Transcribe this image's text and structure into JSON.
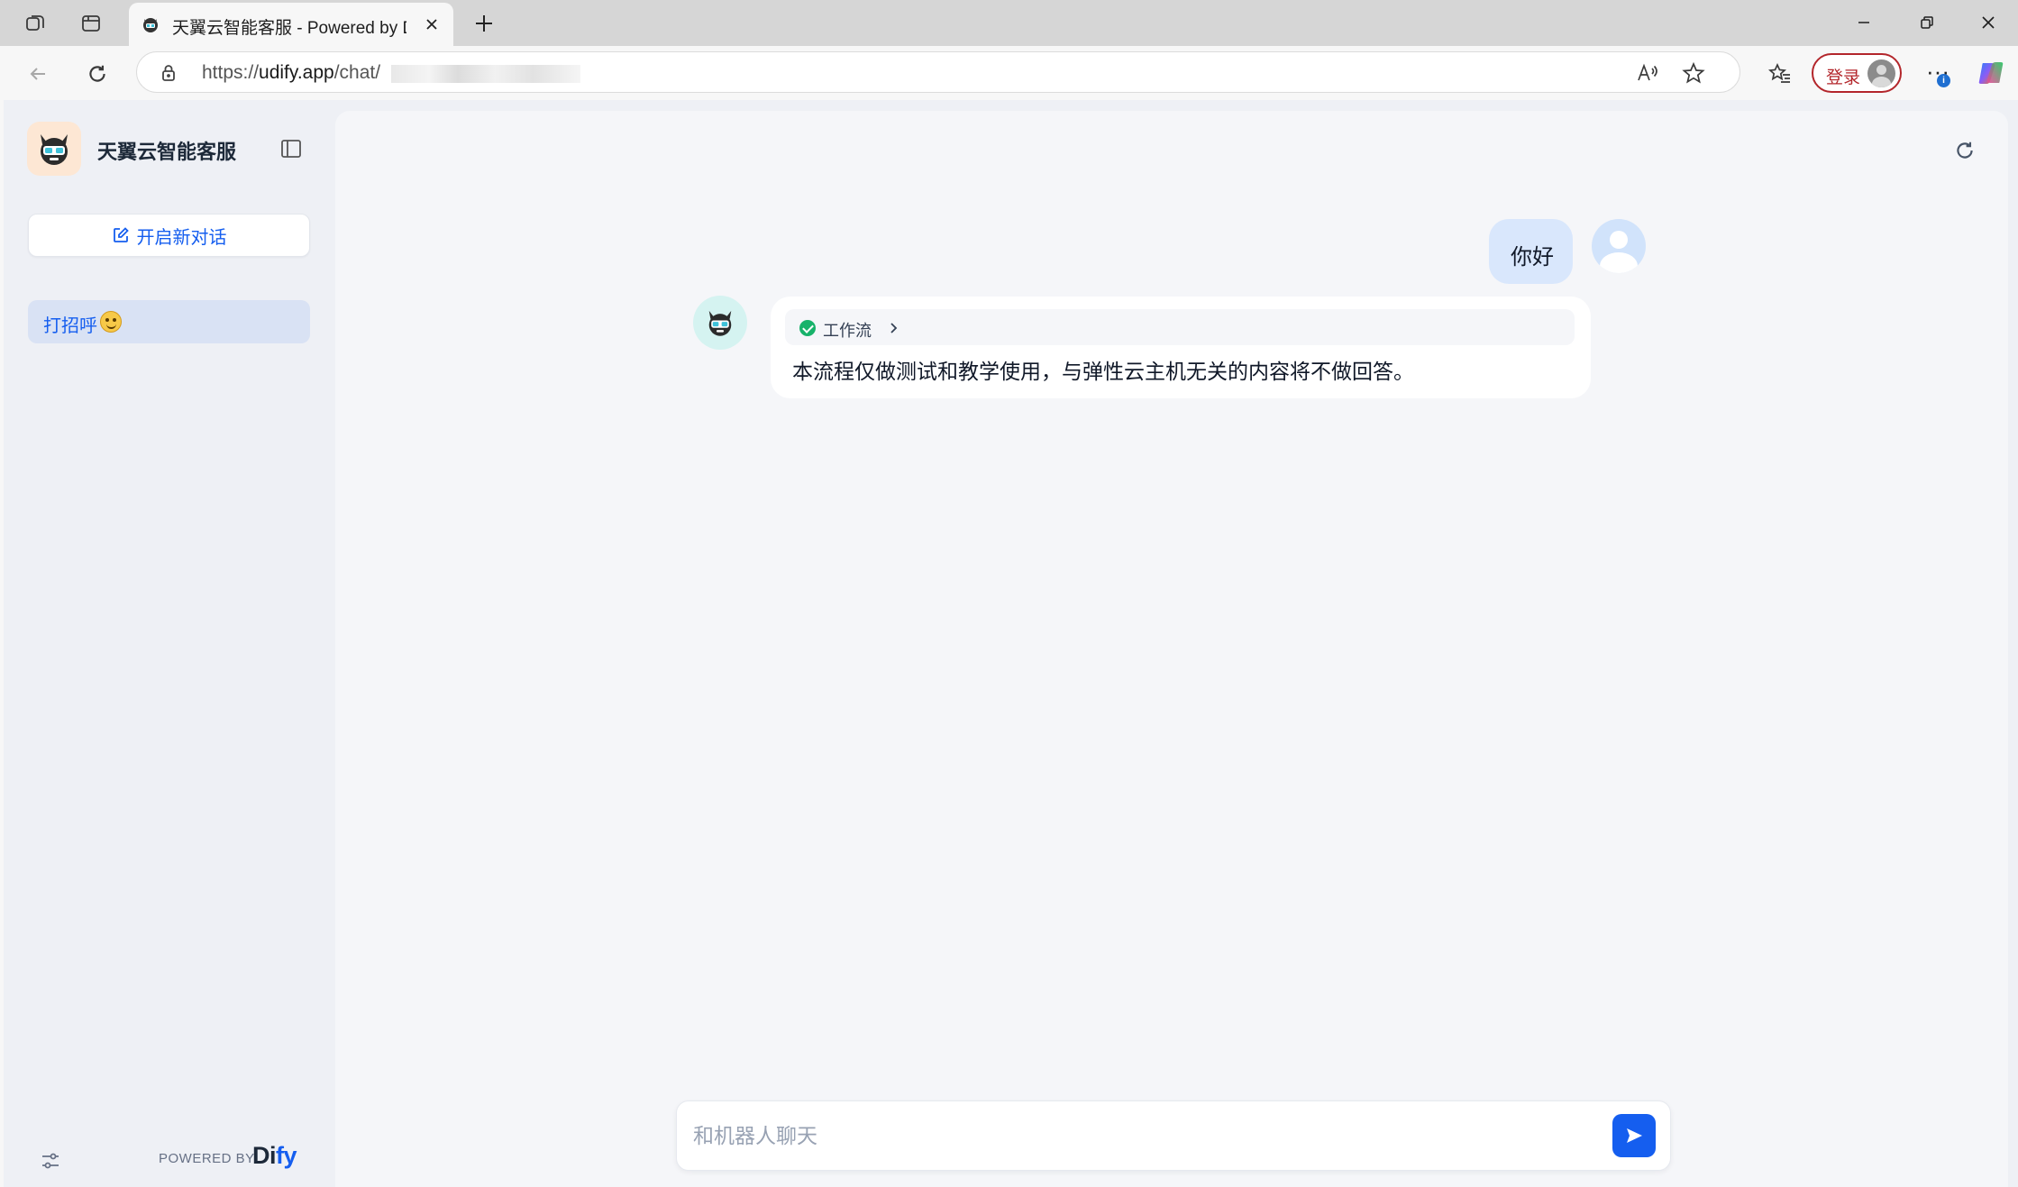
{
  "browser": {
    "tab": {
      "title": "天翼云智能客服 - Powered by Dify"
    },
    "address": {
      "scheme": "https://",
      "host": "udify.app",
      "path": "/chat/"
    },
    "login_label": "登录"
  },
  "sidebar": {
    "app_name": "天翼云智能客服",
    "new_chat_label": "开启新对话",
    "conversations": [
      {
        "label": "打招呼"
      }
    ],
    "footer": {
      "powered_by": "POWERED BY",
      "brand_left": "Di",
      "brand_right": "fy"
    }
  },
  "chat": {
    "messages": [
      {
        "role": "user",
        "text": "你好"
      },
      {
        "role": "assistant",
        "workflow_label": "工作流",
        "workflow_status": "success",
        "text": "本流程仅做测试和教学使用，与弹性云主机无关的内容将不做回答。"
      }
    ],
    "input": {
      "placeholder": "和机器人聊天",
      "value": ""
    }
  },
  "colors": {
    "accent": "#155eef",
    "workflow_success": "#17b26a",
    "login_border": "#b3262b"
  }
}
